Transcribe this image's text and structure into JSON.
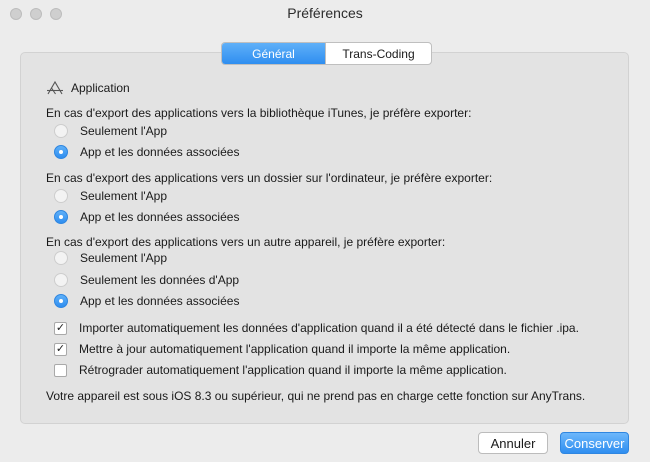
{
  "window": {
    "title": "Préférences"
  },
  "tabs": [
    {
      "label": "Général",
      "active": true
    },
    {
      "label": "Trans-Coding",
      "active": false
    }
  ],
  "section": {
    "title": "Application",
    "icon": "app-store-icon"
  },
  "groups": [
    {
      "question": "En cas d'export des applications vers la bibliothèque iTunes, je préfère exporter:",
      "options": [
        {
          "label": "Seulement l'App",
          "selected": false
        },
        {
          "label": "App et les données associées",
          "selected": true
        }
      ]
    },
    {
      "question": "En cas d'export des applications vers un dossier sur l'ordinateur, je préfère exporter:",
      "options": [
        {
          "label": "Seulement l'App",
          "selected": false
        },
        {
          "label": "App et les données associées",
          "selected": true
        }
      ]
    },
    {
      "question": "En cas d'export des applications vers un autre appareil, je préfère exporter:",
      "options": [
        {
          "label": "Seulement l'App",
          "selected": false
        },
        {
          "label": "Seulement les données d'App",
          "selected": false
        },
        {
          "label": "App et les données associées",
          "selected": true
        }
      ]
    }
  ],
  "checkboxes": [
    {
      "label": "Importer automatiquement les données d'application quand il a été détecté dans le fichier .ipa.",
      "checked": true
    },
    {
      "label": "Mettre à jour automatiquement l'application quand il importe la même application.",
      "checked": true
    },
    {
      "label": "Rétrograder automatiquement l'application quand il importe la même application.",
      "checked": false
    }
  ],
  "note": "Votre appareil est sous iOS 8.3 ou supérieur, qui ne prend pas en charge cette fonction sur AnyTrans.",
  "buttons": {
    "cancel": "Annuler",
    "save": "Conserver"
  },
  "colors": {
    "accent": "#2f8ef0",
    "panel": "#e3e3e3",
    "window": "#ececec"
  }
}
